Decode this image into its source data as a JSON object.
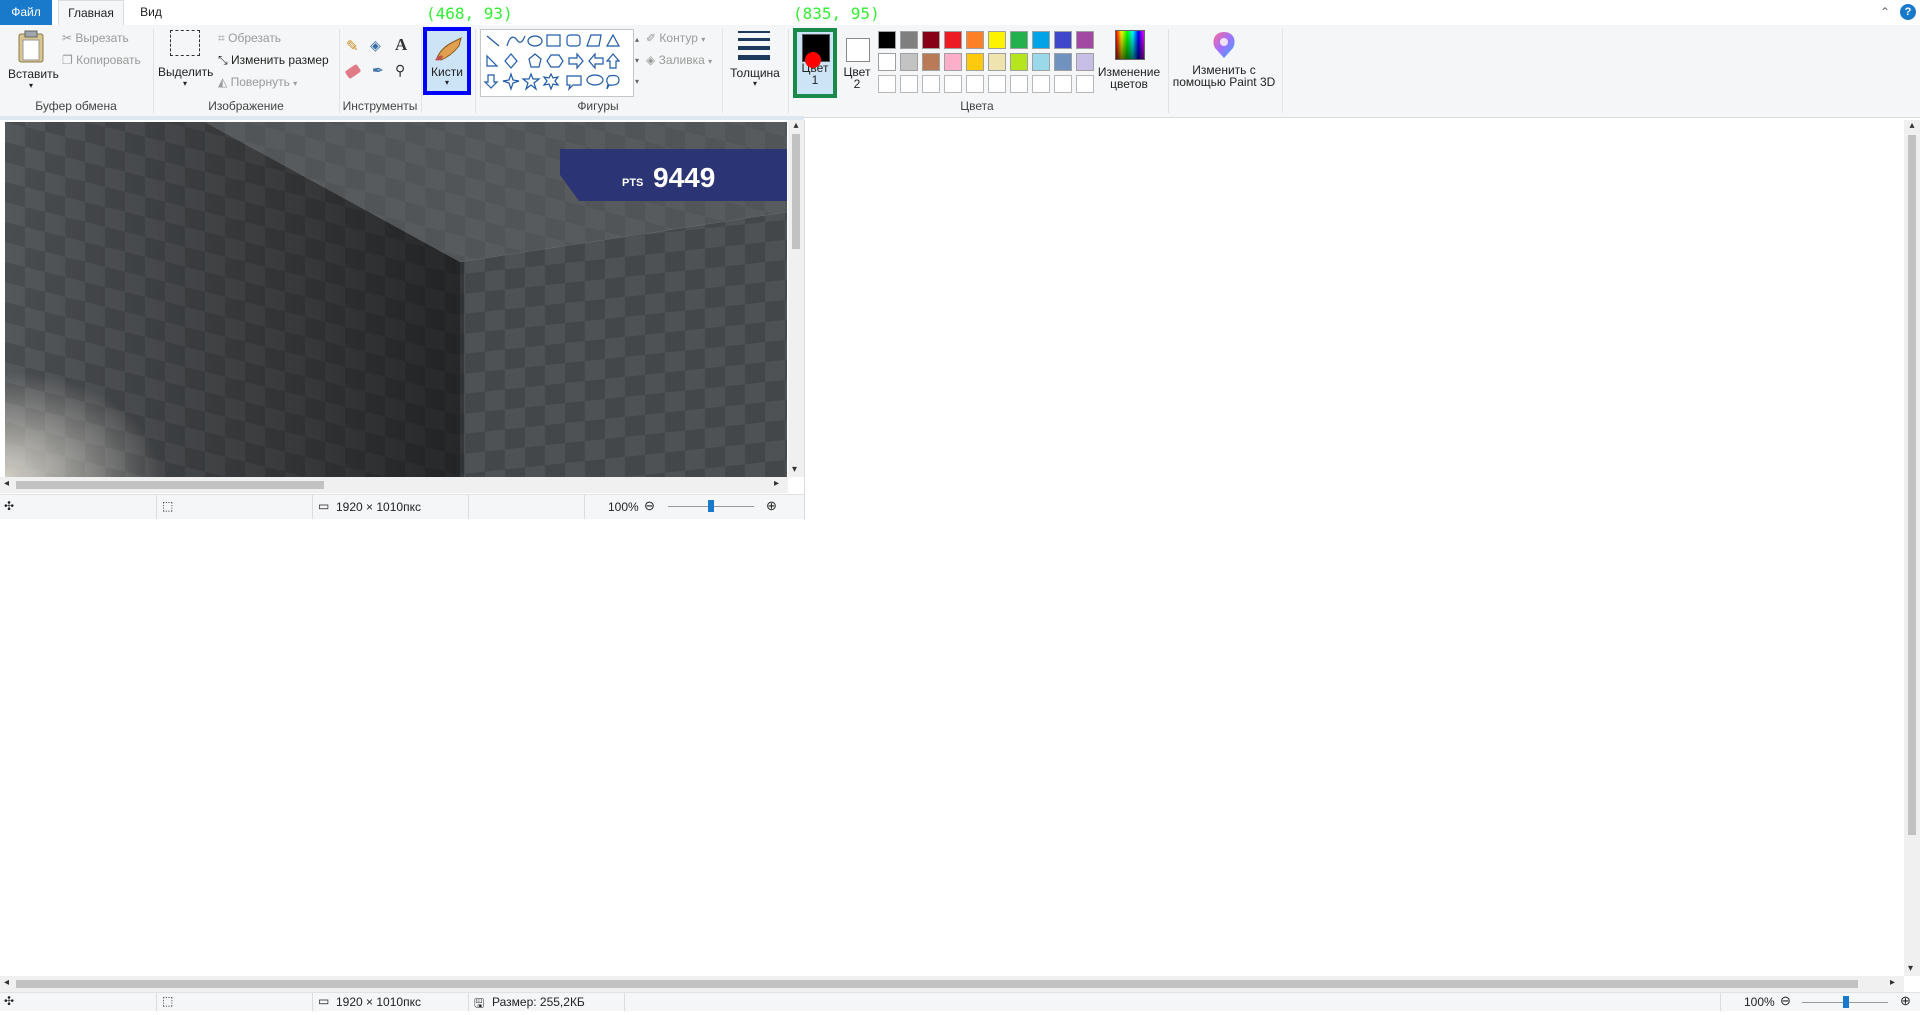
{
  "tabs": {
    "file": "Файл",
    "home": "Главная",
    "view": "Вид"
  },
  "annotations": {
    "brushes_coord": "(468, 93)",
    "color1_coord": "(835, 95)"
  },
  "clipboard": {
    "paste": "Вставить",
    "cut": "Вырезать",
    "copy": "Копировать",
    "group": "Буфер обмена"
  },
  "image": {
    "select": "Выделить",
    "crop": "Обрезать",
    "resize": "Изменить размер",
    "rotate": "Повернуть",
    "group": "Изображение"
  },
  "tools": {
    "group": "Инструменты",
    "brushes": "Кисти"
  },
  "shapes": {
    "outline": "Контур",
    "fill": "Заливка",
    "group": "Фигуры",
    "thickness": "Толщина"
  },
  "colors": {
    "color1": "Цвет\n1",
    "color1_a": "Цвет",
    "color1_b": "1",
    "color2_a": "Цвет",
    "color2_b": "2",
    "edit": "Изменение\nцветов",
    "edit_a": "Изменение",
    "edit_b": "цветов",
    "paint3d_a": "Изменить с",
    "paint3d_b": "помощью Paint 3D",
    "group": "Цвета",
    "palette_row1": [
      "#000000",
      "#7f7f7f",
      "#880015",
      "#ed1c24",
      "#ff7f27",
      "#fff200",
      "#22b14c",
      "#00a2e8",
      "#3f48cc",
      "#a349a4"
    ],
    "palette_row2": [
      "#ffffff",
      "#c3c3c3",
      "#b97a57",
      "#ffaec9",
      "#ffc90e",
      "#efe4b0",
      "#b5e61d",
      "#99d9ea",
      "#7092be",
      "#c8bfe7"
    ],
    "palette_row3": [
      "#ffffff",
      "#ffffff",
      "#ffffff",
      "#ffffff",
      "#ffffff",
      "#ffffff",
      "#ffffff",
      "#ffffff",
      "#ffffff",
      "#ffffff"
    ]
  },
  "game": {
    "pts_label": "PTS",
    "pts_value": "9449"
  },
  "small_status": {
    "dims": "1920 × 1010пкс",
    "zoom": "100%"
  },
  "main_status": {
    "dims": "1920 × 1010пкс",
    "size": "Размер: 255,2КБ",
    "zoom": "100%"
  },
  "accent": "#1979ca",
  "highlight_box": "#0000ff",
  "annotation_color": "#33ee33"
}
